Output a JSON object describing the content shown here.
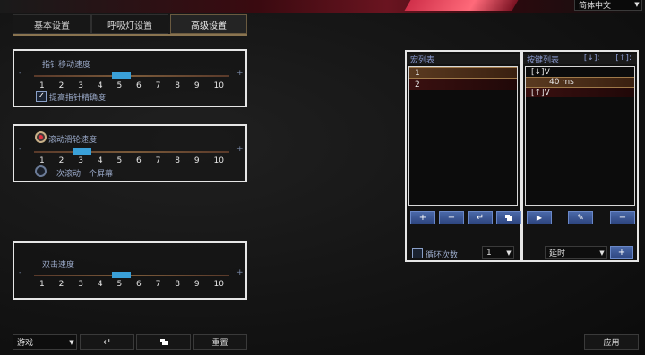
{
  "language": {
    "selected": "简体中文"
  },
  "tabs": [
    {
      "label": "基本设置"
    },
    {
      "label": "呼吸灯设置"
    },
    {
      "label": "高级设置"
    }
  ],
  "pointer": {
    "title": "指针移动速度",
    "minus": "-",
    "plus": "+",
    "ticks": [
      "1",
      "2",
      "3",
      "4",
      "5",
      "6",
      "7",
      "8",
      "9",
      "10"
    ],
    "value": 5,
    "precision_label": "提高指针精确度",
    "precision_checked": true
  },
  "scroll": {
    "title": "滚动滑轮速度",
    "minus": "-",
    "plus": "+",
    "ticks": [
      "1",
      "2",
      "3",
      "4",
      "5",
      "6",
      "7",
      "8",
      "9",
      "10"
    ],
    "value": 3,
    "page_label": "一次滚动一个屏幕"
  },
  "dblclick": {
    "title": "双击速度",
    "minus": "-",
    "plus": "+",
    "ticks": [
      "1",
      "2",
      "3",
      "4",
      "5",
      "6",
      "7",
      "8",
      "9",
      "10"
    ],
    "value": 5
  },
  "macro": {
    "list_title": "宏列表",
    "items": [
      "1",
      "2"
    ],
    "loop_label": "循环次数",
    "loop_value": "1"
  },
  "keys": {
    "list_title": "按键列表",
    "down_label": "[↓]:",
    "up_label": "[↑]:",
    "rows": [
      "[↓]V",
      "40 ms",
      "[↑]V"
    ],
    "delay_label": "延时"
  },
  "icons": {
    "add": "+",
    "remove": "−",
    "play": "▶",
    "edit": "✎",
    "enter": "↵",
    "dropdown": "▼"
  },
  "bottom": {
    "mode": "游戏",
    "reset": "重置",
    "apply": "应用"
  }
}
